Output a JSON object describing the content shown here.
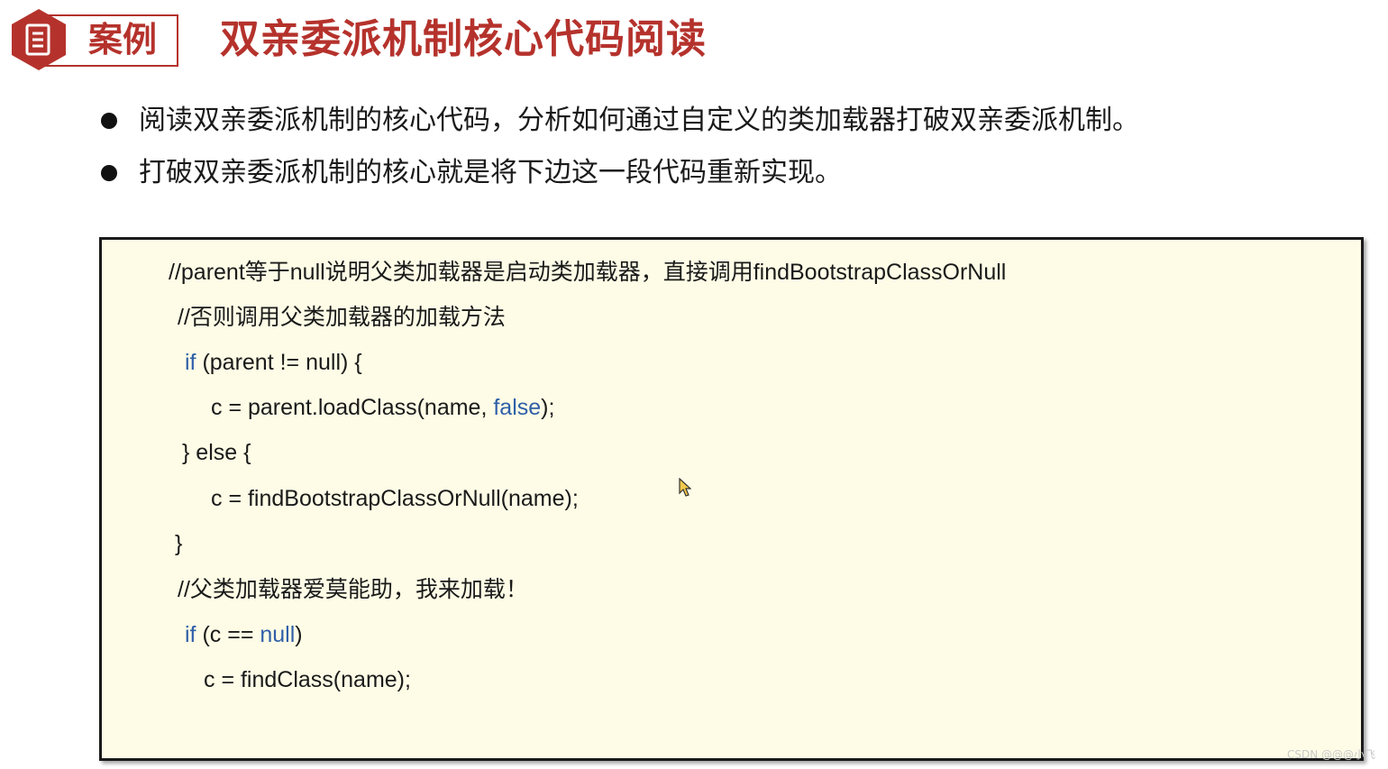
{
  "header": {
    "badge_label": "案例",
    "title": "双亲委派机制核心代码阅读",
    "accent_color": "#b5322c",
    "badge_icon": "document-icon"
  },
  "bullets": [
    {
      "text": "阅读双亲委派机制的核心代码，分析如何通过自定义的类加载器打破双亲委派机制。"
    },
    {
      "text": "打破双亲委派机制的核心就是将下边这一段代码重新实现。"
    }
  ],
  "code": {
    "background_color": "#fefce6",
    "keyword_color": "#2f5fa8",
    "lines": [
      {
        "text": "//parent等于null说明父类加载器是启动类加载器，直接调用findBootstrapClassOrNull"
      },
      {
        "text": "//否则调用父类加载器的加载方法"
      },
      {
        "kw1": "if",
        "text": " (parent != null) {"
      },
      {
        "pre": "c = parent.loadClass(name, ",
        "kw": "false",
        "post": ");"
      },
      {
        "text": "} else {"
      },
      {
        "text": "c = findBootstrapClassOrNull(name);"
      },
      {
        "text": "}"
      },
      {
        "text": "//父类加载器爱莫能助，我来加载！"
      },
      {
        "kw1": "if",
        "pre": " (c == ",
        "kw": "null",
        "post": ")"
      },
      {
        "text": "c = findClass(name);"
      }
    ]
  },
  "watermark": "CSDN @@@小飞"
}
